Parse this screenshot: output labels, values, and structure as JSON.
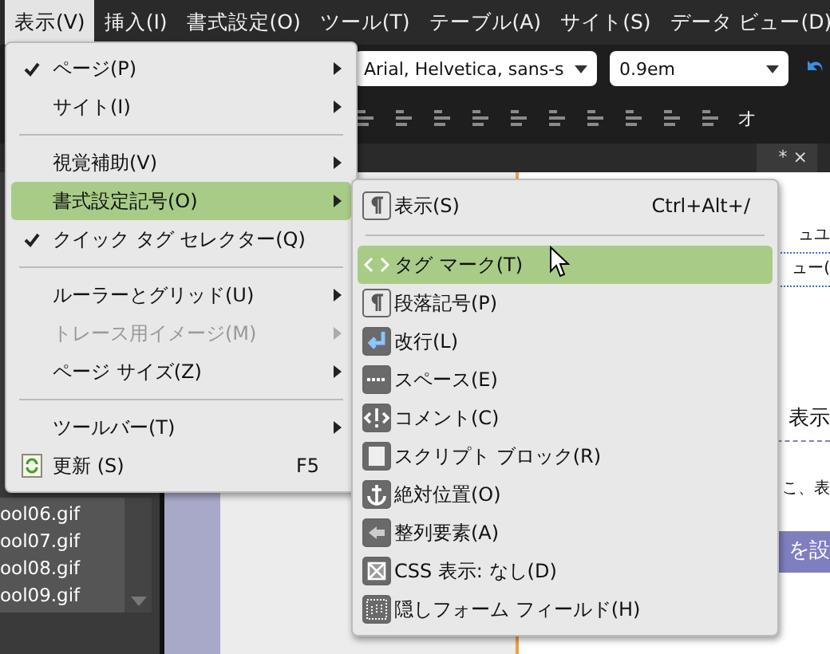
{
  "menubar": [
    {
      "label": "表示(V)",
      "selected": true
    },
    {
      "label": "挿入(I)",
      "selected": false
    },
    {
      "label": "書式設定(O)",
      "selected": false
    },
    {
      "label": "ツール(T)",
      "selected": false
    },
    {
      "label": "テーブル(A)",
      "selected": false
    },
    {
      "label": "サイト(S)",
      "selected": false
    },
    {
      "label": "データ ビュー(D)",
      "selected": false
    }
  ],
  "toolbar": {
    "font_field": "Arial, Helvetica, sans-s",
    "size_field": "0.9em",
    "cut_label": "オ"
  },
  "tab": {
    "label": "*",
    "close": "×"
  },
  "files": [
    "ool06.gif",
    "ool07.gif",
    "ool08.gif",
    "ool09.gif"
  ],
  "document": [
    {
      "kind": "plain",
      "text": "ュユ"
    },
    {
      "kind": "plain",
      "text": "ュー("
    },
    {
      "kind": "heading",
      "text": "表示"
    },
    {
      "kind": "plain",
      "text": "こ、表"
    },
    {
      "kind": "bar",
      "text": "を設"
    }
  ],
  "view_menu": [
    {
      "kind": "item",
      "label": "ページ(P)",
      "checked": true,
      "submenu": true,
      "disabled": false,
      "selected": false
    },
    {
      "kind": "item",
      "label": "サイト(I)",
      "checked": false,
      "submenu": true,
      "disabled": false,
      "selected": false
    },
    {
      "kind": "separator"
    },
    {
      "kind": "item",
      "label": "視覚補助(V)",
      "checked": false,
      "submenu": true,
      "disabled": false,
      "selected": false
    },
    {
      "kind": "item",
      "label": "書式設定記号(O)",
      "checked": false,
      "submenu": true,
      "disabled": false,
      "selected": true
    },
    {
      "kind": "item",
      "label": "クイック タグ セレクター(Q)",
      "checked": true,
      "submenu": false,
      "disabled": false,
      "selected": false
    },
    {
      "kind": "separator"
    },
    {
      "kind": "item",
      "label": "ルーラーとグリッド(U)",
      "checked": false,
      "submenu": true,
      "disabled": false,
      "selected": false
    },
    {
      "kind": "item",
      "label": "トレース用イメージ(M)",
      "checked": false,
      "submenu": true,
      "disabled": true,
      "selected": false
    },
    {
      "kind": "item",
      "label": "ページ サイズ(Z)",
      "checked": false,
      "submenu": true,
      "disabled": false,
      "selected": false
    },
    {
      "kind": "separator"
    },
    {
      "kind": "item",
      "label": "ツールバー(T)",
      "checked": false,
      "submenu": true,
      "disabled": false,
      "selected": false
    },
    {
      "kind": "refresh",
      "label": "更新 (S)",
      "shortcut": "F5",
      "checked": false,
      "submenu": false,
      "disabled": false,
      "selected": false
    }
  ],
  "marks_menu": [
    {
      "kind": "item",
      "label": "表示(S)",
      "shortcut": "Ctrl+Alt+/",
      "selected": false
    },
    {
      "kind": "separator"
    },
    {
      "kind": "item",
      "label": "タグ マーク(T)",
      "selected": true
    },
    {
      "kind": "item",
      "label": "段落記号(P)",
      "selected": false
    },
    {
      "kind": "item",
      "label": "改行(L)",
      "selected": false
    },
    {
      "kind": "item",
      "label": "スペース(E)",
      "selected": false
    },
    {
      "kind": "item",
      "label": "コメント(C)",
      "selected": false
    },
    {
      "kind": "item",
      "label": "スクリプト ブロック(R)",
      "selected": false
    },
    {
      "kind": "item",
      "label": "絶対位置(O)",
      "selected": false
    },
    {
      "kind": "item",
      "label": "整列要素(A)",
      "selected": false
    },
    {
      "kind": "item",
      "label": "CSS 表示: なし(D)",
      "selected": false
    },
    {
      "kind": "item",
      "label": "隠しフォーム フィールド(H)",
      "selected": false
    }
  ]
}
